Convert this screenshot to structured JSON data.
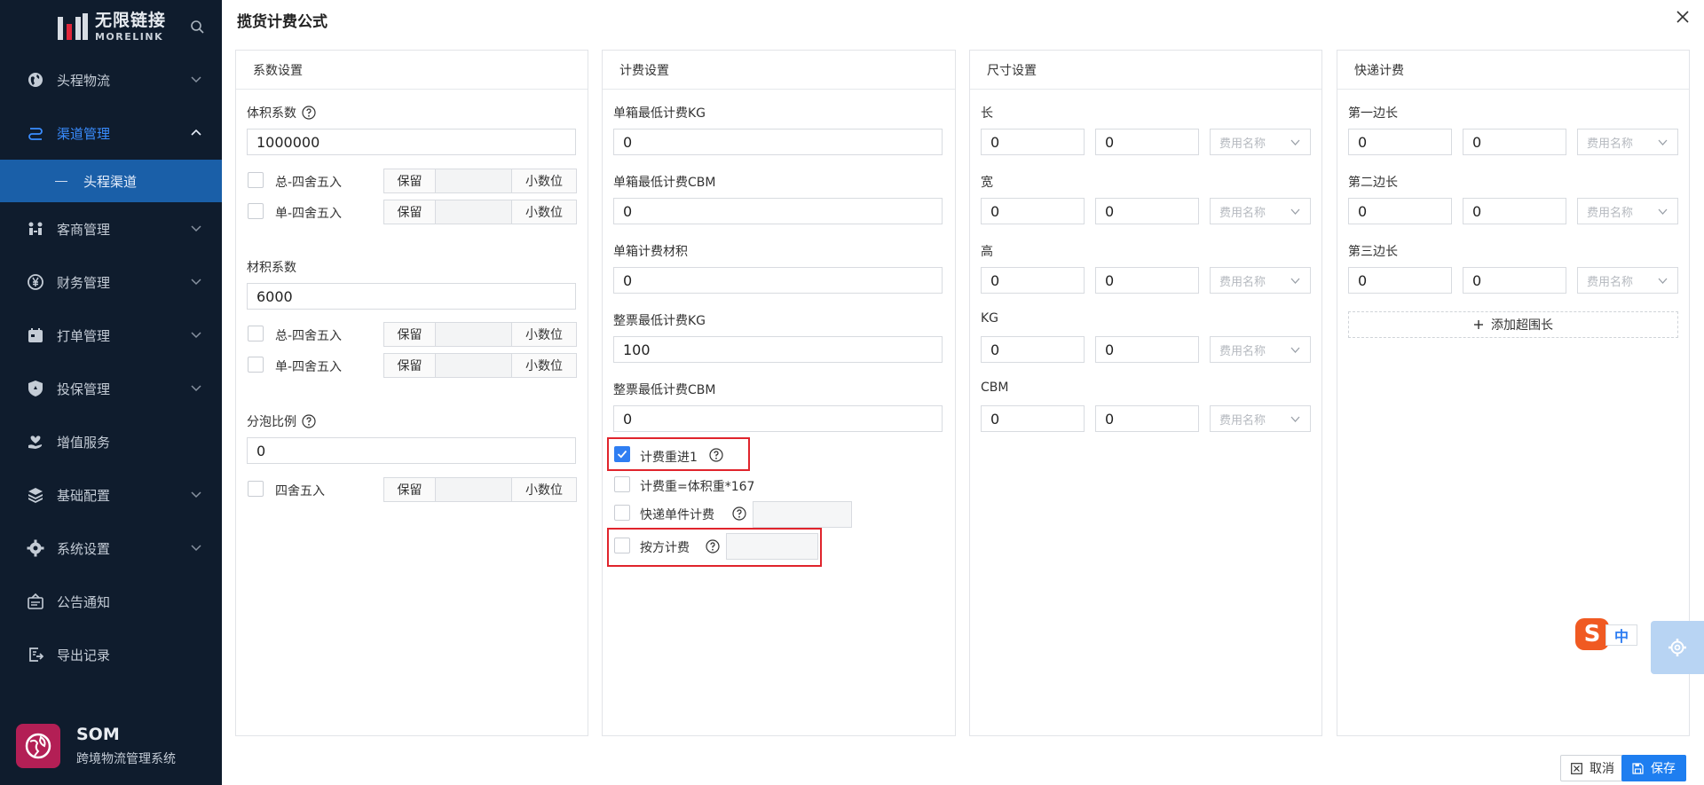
{
  "sidebar": {
    "logo": {
      "cn": "无限链接",
      "en": "MORELINK"
    },
    "items": [
      {
        "label": "头程物流",
        "icon": "globe-icon",
        "expanded": false
      },
      {
        "label": "渠道管理",
        "icon": "route-icon",
        "expanded": true,
        "active": true
      },
      {
        "label": "客商管理",
        "icon": "people-icon",
        "expanded": false
      },
      {
        "label": "财务管理",
        "icon": "yen-icon",
        "expanded": false
      },
      {
        "label": "打单管理",
        "icon": "calendar-icon",
        "expanded": false
      },
      {
        "label": "投保管理",
        "icon": "shield-icon",
        "expanded": false
      },
      {
        "label": "增值服务",
        "icon": "heart-hand-icon",
        "expanded": false
      },
      {
        "label": "基础配置",
        "icon": "layers-icon",
        "expanded": false
      },
      {
        "label": "系统设置",
        "icon": "gear-icon",
        "expanded": false
      },
      {
        "label": "公告通知",
        "icon": "announcement-icon",
        "expanded": false
      },
      {
        "label": "导出记录",
        "icon": "export-icon",
        "expanded": false
      }
    ],
    "sub_item": "头程渠道",
    "brand": {
      "name": "SOM",
      "subtitle": "跨境物流管理系统"
    }
  },
  "dialog": {
    "title": "揽货计费公式",
    "coef": {
      "head": "系数设置",
      "volume_label": "体积系数",
      "volume_value": "1000000",
      "material_label": "材积系数",
      "material_value": "6000",
      "split_label": "分泡比例",
      "split_value": "0",
      "round_total": "总-四舍五入",
      "round_single": "单-四舍五入",
      "round": "四舍五入",
      "keep": "保留",
      "decimals": "小数位"
    },
    "fee": {
      "head": "计费设置",
      "min_box_kg_label": "单箱最低计费KG",
      "min_box_kg_value": "0",
      "min_box_cbm_label": "单箱最低计费CBM",
      "min_box_cbm_value": "0",
      "box_volume_label": "单箱计费材积",
      "box_volume_value": "0",
      "min_ticket_kg_label": "整票最低计费KG",
      "min_ticket_kg_value": "100",
      "min_ticket_cbm_label": "整票最低计费CBM",
      "min_ticket_cbm_value": "0",
      "cb_round_up": "计费重进1",
      "cb_formula": "计费重=体积重*167",
      "cb_express_single": "快递单件计费",
      "cb_by_cbm": "按方计费"
    },
    "size": {
      "head": "尺寸设置",
      "rows": [
        {
          "label": "长",
          "v1": "0",
          "v2": "0",
          "placeholder": "费用名称"
        },
        {
          "label": "宽",
          "v1": "0",
          "v2": "0",
          "placeholder": "费用名称"
        },
        {
          "label": "高",
          "v1": "0",
          "v2": "0",
          "placeholder": "费用名称"
        },
        {
          "label": "KG",
          "v1": "0",
          "v2": "0",
          "placeholder": "费用名称"
        },
        {
          "label": "CBM",
          "v1": "0",
          "v2": "0",
          "placeholder": "费用名称"
        }
      ]
    },
    "express": {
      "head": "快递计费",
      "rows": [
        {
          "label": "第一边长",
          "v1": "0",
          "v2": "0",
          "placeholder": "费用名称"
        },
        {
          "label": "第二边长",
          "v1": "0",
          "v2": "0",
          "placeholder": "费用名称"
        },
        {
          "label": "第三边长",
          "v1": "0",
          "v2": "0",
          "placeholder": "费用名称"
        }
      ],
      "add_label": "添加超围长"
    },
    "cancel_label": "取消",
    "save_label": "保存"
  },
  "ime": {
    "s": "S",
    "lang": "中"
  },
  "colors": {
    "sidebar_bg": "#0f1c2d",
    "active": "#3a8dff",
    "primary": "#1e7ef0",
    "highlight": "#e0242c"
  }
}
